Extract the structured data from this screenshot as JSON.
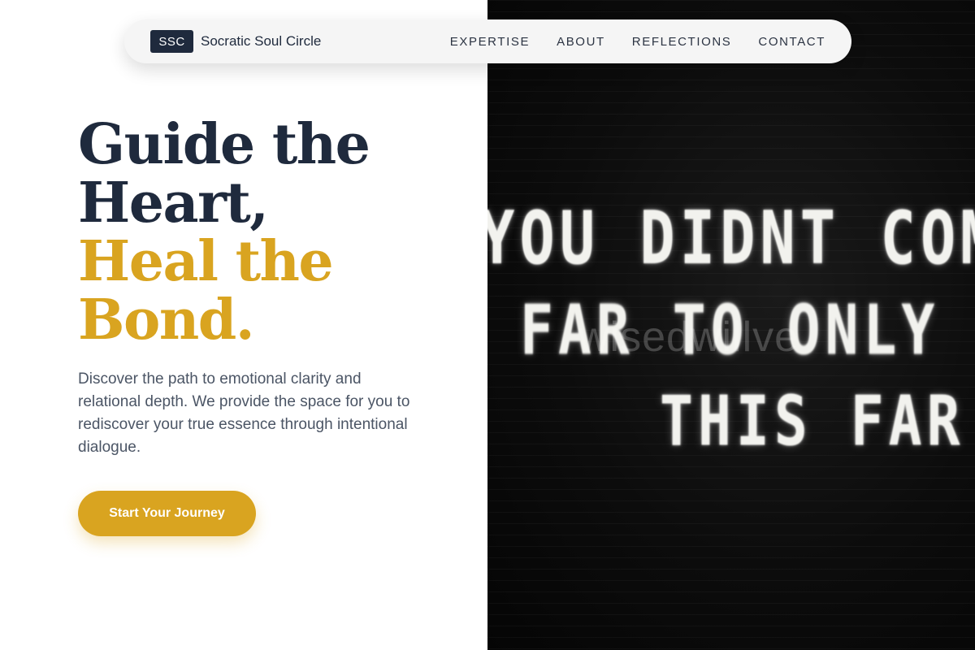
{
  "nav": {
    "brand_badge": "SSC",
    "brand_name": "Socratic Soul Circle",
    "links": [
      "EXPERTISE",
      "ABOUT",
      "REFLECTIONS",
      "CONTACT"
    ]
  },
  "hero": {
    "headline_line1": "Guide the",
    "headline_line2": "Heart,",
    "headline_line3": "Heal the",
    "headline_line4": "Bond.",
    "subtext": "Discover the path to emotional clarity and relational depth. We provide the space for you to rediscover your true essence through intentional dialogue.",
    "cta_label": "Start Your Journey"
  },
  "image": {
    "board_line1": "YOU DIDNT COME T",
    "board_line2": "FAR TO ONLY COM",
    "board_line3": "THIS FAR",
    "watermark": "wisedwillve"
  },
  "colors": {
    "navy": "#1f2a3d",
    "gold": "#d9a420",
    "body_text": "#4b5565",
    "nav_bg": "#f5f5f5"
  }
}
